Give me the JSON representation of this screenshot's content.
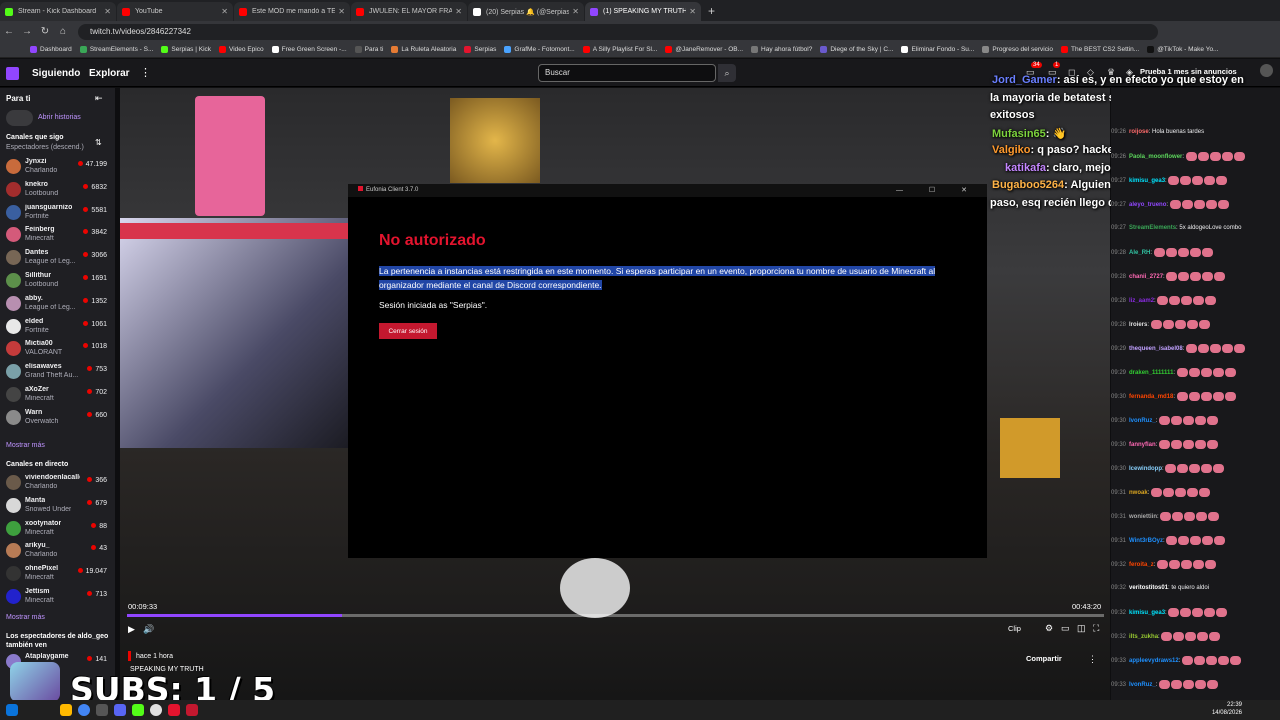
{
  "browser": {
    "tabs": [
      {
        "title": "Stream - Kick Dashboard",
        "color": "#53fc18",
        "active": false
      },
      {
        "title": "YouTube",
        "color": "#ff0000",
        "active": false
      },
      {
        "title": "Este MOD me mandó a TERAP",
        "color": "#ff0000",
        "active": false
      },
      {
        "title": "JWULEN: EL MAYOR FRAUDE D",
        "color": "#ff0000",
        "active": false
      },
      {
        "title": "(20) Serpias 🔔 (@Serpias) / X",
        "color": "#ffffff",
        "active": false
      },
      {
        "title": "(1) SPEAKING MY TRUTH - Twi",
        "color": "#9146ff",
        "active": true
      }
    ],
    "new_tab": "+",
    "url": "twitch.tv/videos/2846227342",
    "bookmarks": [
      "Dashboard",
      "StreamElements - S...",
      "Serpias | Kick",
      "Video Epico",
      "Free Green Screen -...",
      "Para ti",
      "La Ruleta Aleatoria",
      "Serpias",
      "GrafMe - Fotomont...",
      "A Silly Playlist For Sl...",
      "@JaneRemover - OB...",
      "Hay ahora fútbol?",
      "Diege of the Sky | C...",
      "Eliminar Fondo - Su...",
      "Progreso del servicio",
      "The BEST CS2 Settin...",
      "@TikTok - Make Yo..."
    ]
  },
  "header": {
    "following": "Siguiendo",
    "browse": "Explorar",
    "more": "⋮",
    "search_placeholder": "Buscar",
    "prime": "Prueba 1 mes sin anuncios",
    "badge_a": "34",
    "badge_b": "1"
  },
  "sidebar": {
    "for_you": "Para ti",
    "collapse": "⇤",
    "stories": "Abrir historias",
    "followed_title": "Canales que sigo",
    "followed_sort": "Espectadores (descend.)",
    "followed": [
      {
        "name": "Jynxzi",
        "game": "Charlando",
        "viewers": "47.199",
        "color": "#c86b3c"
      },
      {
        "name": "knekro",
        "game": "Lootbound",
        "viewers": "6832",
        "color": "#a32d2d"
      },
      {
        "name": "juansguarnizo",
        "game": "Fortnite",
        "viewers": "5581",
        "color": "#3a5fa0"
      },
      {
        "name": "Feinberg",
        "game": "Minecraft",
        "viewers": "3842",
        "color": "#d45a7a"
      },
      {
        "name": "Dantes",
        "game": "League of Leg...",
        "viewers": "3066",
        "color": "#776655"
      },
      {
        "name": "Sillithur",
        "game": "Lootbound",
        "viewers": "1691",
        "color": "#5c8f4a"
      },
      {
        "name": "abby.",
        "game": "League of Leg...",
        "viewers": "1352",
        "color": "#b88fb0"
      },
      {
        "name": "elded",
        "game": "Fortnite",
        "viewers": "1061",
        "color": "#e8e8e8"
      },
      {
        "name": "Mictia00",
        "game": "VALORANT",
        "viewers": "1018",
        "color": "#c43b3b"
      },
      {
        "name": "elisawaves",
        "game": "Grand Theft Au...",
        "viewers": "753",
        "color": "#7aa0a8"
      },
      {
        "name": "aXoZer",
        "game": "Minecraft",
        "viewers": "702",
        "color": "#444"
      },
      {
        "name": "Warn",
        "game": "Overwatch",
        "viewers": "660",
        "color": "#8a8a8a"
      }
    ],
    "show_more": "Mostrar más",
    "live_title": "Canales en directo",
    "live": [
      {
        "name": "viviendoenlacalle",
        "game": "Charlando",
        "viewers": "366",
        "color": "#6a5a4a"
      },
      {
        "name": "Manta",
        "game": "Snowed Under",
        "viewers": "679",
        "color": "#d8d8d8"
      },
      {
        "name": "xootynator",
        "game": "Minecraft",
        "viewers": "88",
        "color": "#3ea03e"
      },
      {
        "name": "arikyu_",
        "game": "Charlando",
        "viewers": "43",
        "color": "#b77b55"
      },
      {
        "name": "ohnePixel",
        "game": "Minecraft",
        "viewers": "19.047",
        "color": "#333"
      },
      {
        "name": "Jettism",
        "game": "Minecraft",
        "viewers": "713",
        "color": "#2222cc"
      }
    ],
    "show_more_2": "Mostrar más",
    "also_watch": "Los espectadores de aldo_geo también ven",
    "also": [
      {
        "name": "Ataplaygame",
        "viewers": "141",
        "color": "#8a7acb"
      }
    ]
  },
  "dialog": {
    "window_title": "Eufonia Client 3.7.0",
    "window_controls": "— ☐ ✕",
    "heading": "No autorizado",
    "message": "La pertenencia a instancias está restringida en este momento. Si esperas participar en un evento, proporciona tu nombre de usuario de Minecraft al organizador mediante el canal de Discord correspondiente.",
    "session": "Sesión iniciada as \"Serpias\".",
    "logout": "Cerrar sesión"
  },
  "player": {
    "current": "00:09:33",
    "total": "00:43:20",
    "progress": 0.22,
    "clip": "Clip",
    "play": "▶",
    "volume": "🔊",
    "subs_overlay": "SUBS: 1 / 5"
  },
  "info": {
    "time": "hace 1 hora",
    "title": "SPEAKING MY TRUTH",
    "share": "Compartir"
  },
  "overlay_chat": [
    {
      "user": "Jord_Gamer",
      "color": "#6a7fff",
      "text": ": así es, y en efecto yo que estoy en"
    },
    {
      "user": "",
      "color": "#fff",
      "text": "la mayoria de betatest solo saben mejorar esos"
    },
    {
      "user": "",
      "color": "#fff",
      "text": "exitosos"
    },
    {
      "user": "Mufasin65",
      "color": "#7dd33d",
      "text": ": 👋"
    },
    {
      "user": "Valgiko",
      "color": "#ff9a2e",
      "text": ": q paso? hackearon el servidor?"
    },
    {
      "user": "katikafa",
      "color": "#c486ff",
      "text": ": claro, mejor es asi por la whitelist"
    },
    {
      "user": "Bugaboo5264",
      "color": "#ffb347",
      "text": ": Alguien me da contexto de q"
    },
    {
      "user": "",
      "color": "#fff",
      "text": "paso, esq recién llego qwq"
    }
  ],
  "chat": [
    {
      "ts": "09:26",
      "user": "roijose",
      "color": "#ff6b6b",
      "text": "Hola buenas tardes"
    },
    {
      "ts": "09:26",
      "user": "Paola_moonflower",
      "color": "#5cd65c",
      "text": ""
    },
    {
      "ts": "09:27",
      "user": "kimisu_gea3",
      "color": "#00e5ff",
      "text": ""
    },
    {
      "ts": "09:27",
      "user": "aleyo_trueno",
      "color": "#9147ff",
      "text": ""
    },
    {
      "ts": "09:27",
      "user": "StreamElements",
      "color": "#3aa757",
      "text": "5x aldogeoLove combo"
    },
    {
      "ts": "09:28",
      "user": "Ale_RH",
      "color": "#31c3a2",
      "text": ""
    },
    {
      "ts": "09:28",
      "user": "chanii_2727",
      "color": "#ff69b4",
      "text": ""
    },
    {
      "ts": "09:28",
      "user": "liz_aam2",
      "color": "#8a2be2",
      "text": ""
    },
    {
      "ts": "09:28",
      "user": "lroiers",
      "color": "#e0e0e0",
      "text": ""
    },
    {
      "ts": "09:29",
      "user": "thequeen_isabel08",
      "color": "#c0a0ff",
      "text": ""
    },
    {
      "ts": "09:29",
      "user": "draken_1111111",
      "color": "#32cd32",
      "text": ""
    },
    {
      "ts": "09:30",
      "user": "fernanda_md18",
      "color": "#ff4500",
      "text": ""
    },
    {
      "ts": "09:30",
      "user": "IvonRuz_",
      "color": "#1e90ff",
      "text": ""
    },
    {
      "ts": "09:30",
      "user": "fannyflan",
      "color": "#ff69b4",
      "text": ""
    },
    {
      "ts": "09:30",
      "user": "Icewindopp",
      "color": "#87cefa",
      "text": ""
    },
    {
      "ts": "09:31",
      "user": "nwoak",
      "color": "#daa520",
      "text": ""
    },
    {
      "ts": "09:31",
      "user": "woniettiin",
      "color": "#aaa",
      "text": ""
    },
    {
      "ts": "09:31",
      "user": "Wint3rBOyz",
      "color": "#1e90ff",
      "text": ""
    },
    {
      "ts": "09:32",
      "user": "feroita_z",
      "color": "#ff4500",
      "text": ""
    },
    {
      "ts": "09:32",
      "user": "veritostitos01",
      "color": "#fff",
      "text": "te quiero aldoi"
    },
    {
      "ts": "09:32",
      "user": "kimisu_gea3",
      "color": "#00e5ff",
      "text": ""
    },
    {
      "ts": "09:32",
      "user": "ilts_zukha",
      "color": "#9acd32",
      "text": ""
    },
    {
      "ts": "09:33",
      "user": "appleevydraws12",
      "color": "#1e90ff",
      "text": ""
    },
    {
      "ts": "09:33",
      "user": "IvonRuz_",
      "color": "#1e90ff",
      "text": ""
    }
  ],
  "taskbar": {
    "time": "22:39",
    "date": "14/08/2026"
  }
}
